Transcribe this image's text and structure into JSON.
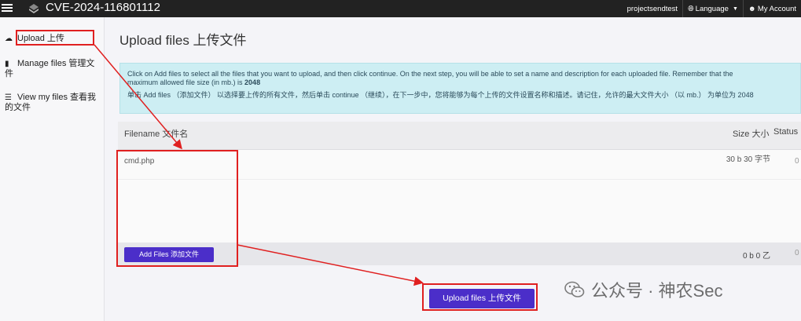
{
  "topbar": {
    "title": "CVE-2024-116801112",
    "user_label": "projectsendtest",
    "language_label": "Language",
    "account_label": "My Account"
  },
  "sidebar": {
    "items": [
      {
        "label": "Upload 上传",
        "icon": "cloud-upload-icon"
      },
      {
        "label": "Manage files 管理文件",
        "icon": "file-icon"
      },
      {
        "label": "View my files 查看我的文件",
        "icon": "list-icon"
      }
    ]
  },
  "main": {
    "title": "Upload files 上传文件",
    "alert": {
      "line1": "Click on Add files to select all the files that you want to upload, and then click continue. On the next step, you will be able to set a name and description for each uploaded file. Remember that the",
      "line2_prefix": "maximum allowed file size (in mb.) is ",
      "max_size": "2048",
      "line3": "单击 Add files （添加文件） 以选择要上传的所有文件，然后单击 continue （继续），在下一步中，您将能够为每个上传的文件设置名称和描述。请记住，允许的最大文件大小 （以 mb.） 为单位为 2048"
    },
    "table": {
      "col_filename": "Filename 文件名",
      "col_size": "Size 大小",
      "col_status": "Status",
      "rows": [
        {
          "filename": "cmd.php",
          "size": "30 b 30 字节",
          "status": "0"
        }
      ],
      "footer_size": "0 b 0 乙",
      "footer_status": "0"
    },
    "add_files_label": "Add Files 添加文件",
    "upload_button_label": "Upload files 上传文件"
  },
  "watermark": {
    "text": "公众号 · 神农Sec"
  },
  "colors": {
    "accent": "#4b2ec9",
    "annotation_red": "#e02020",
    "topbar_bg": "#222222",
    "alert_bg": "#cdeef3"
  }
}
